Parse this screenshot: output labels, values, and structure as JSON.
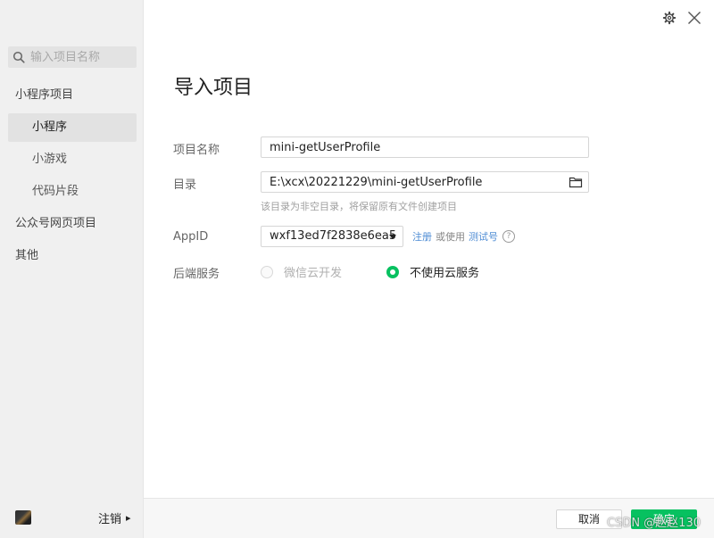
{
  "sidebar": {
    "search_placeholder": "输入项目名称",
    "items": [
      {
        "label": "小程序项目"
      },
      {
        "label": "小程序"
      },
      {
        "label": "小游戏"
      },
      {
        "label": "代码片段"
      },
      {
        "label": "公众号网页项目"
      },
      {
        "label": "其他"
      }
    ],
    "logout_label": "注销"
  },
  "dialog": {
    "title": "导入项目",
    "project_name": {
      "label": "项目名称",
      "value": "mini-getUserProfile"
    },
    "directory": {
      "label": "目录",
      "value": "E:\\xcx\\20221229\\mini-getUserProfile",
      "hint": "该目录为非空目录，将保留原有文件创建项目"
    },
    "appid": {
      "label": "AppID",
      "value": "wxf13ed7f2838e6ea5",
      "register_link": "注册",
      "or_use": "或使用",
      "test_link": "测试号",
      "help": "?"
    },
    "backend": {
      "label": "后端服务",
      "options": [
        {
          "label": "微信云开发",
          "state": "disabled"
        },
        {
          "label": "不使用云服务",
          "state": "checked"
        }
      ]
    }
  },
  "footer": {
    "cancel_label": "取消",
    "confirm_label": "确定",
    "watermark": "CSDN @赵赵130"
  },
  "colors": {
    "accent": "#07c160",
    "link": "#4e8cd4",
    "sidebar_bg": "#f0f0f0"
  },
  "icons": [
    "search-icon",
    "gear-icon",
    "close-icon",
    "folder-icon",
    "help-icon",
    "chevron-right-icon"
  ]
}
